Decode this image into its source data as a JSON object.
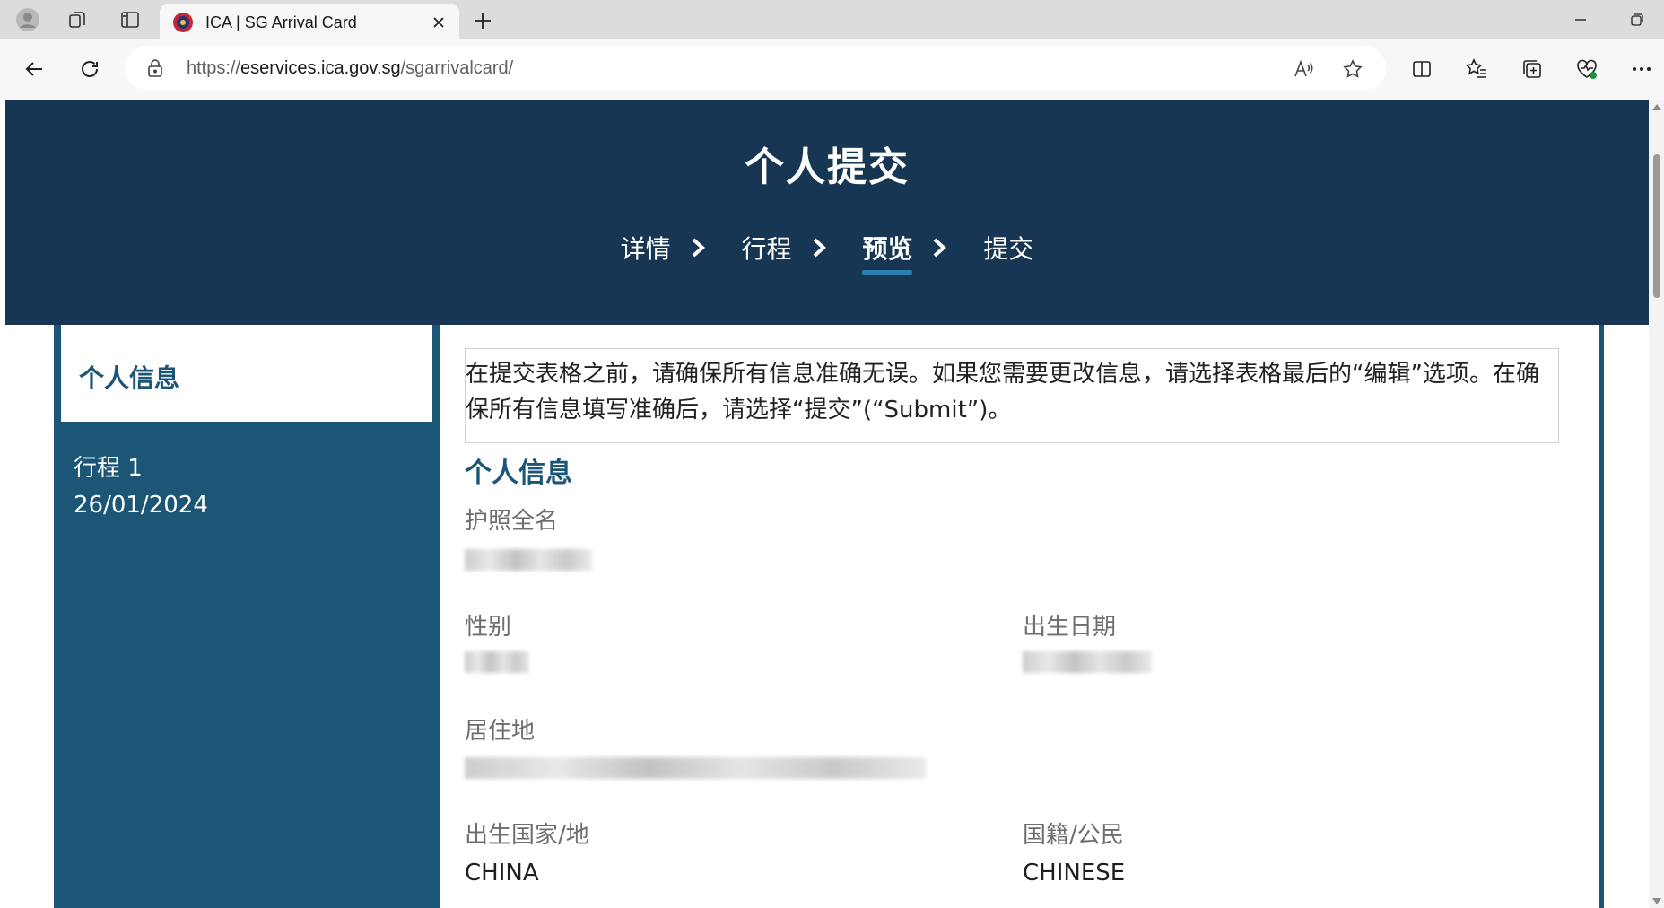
{
  "browser": {
    "tab_title": "ICA | SG Arrival Card",
    "url_prefix": "https://",
    "url_host": "eservices.ica.gov.sg",
    "url_path": "/sgarrivalcard/"
  },
  "header": {
    "title": "个人提交",
    "steps": [
      {
        "label": "详情"
      },
      {
        "label": "行程"
      },
      {
        "label": "预览",
        "active": true
      },
      {
        "label": "提交"
      }
    ]
  },
  "sidebar": {
    "active_item": "个人信息",
    "trip_label": "行程 1",
    "trip_date": "26/01/2024"
  },
  "main": {
    "notice": "在提交表格之前，请确保所有信息准确无误。如果您需要更改信息，请选择表格最后的“编辑”选项。在确保所有信息填写准确后，请选择“提交”(“Submit”)。",
    "section_title": "个人信息",
    "fields": {
      "full_name_label": "护照全名",
      "sex_label": "性别",
      "dob_label": "出生日期",
      "residence_label": "居住地",
      "birth_country_label": "出生国家/地",
      "birth_country_value": "CHINA",
      "nationality_label": "国籍/公民",
      "nationality_value": "CHINESE"
    }
  },
  "colors": {
    "banner": "#163654",
    "sidebar": "#1c5676",
    "accent": "#2a7fb1"
  }
}
